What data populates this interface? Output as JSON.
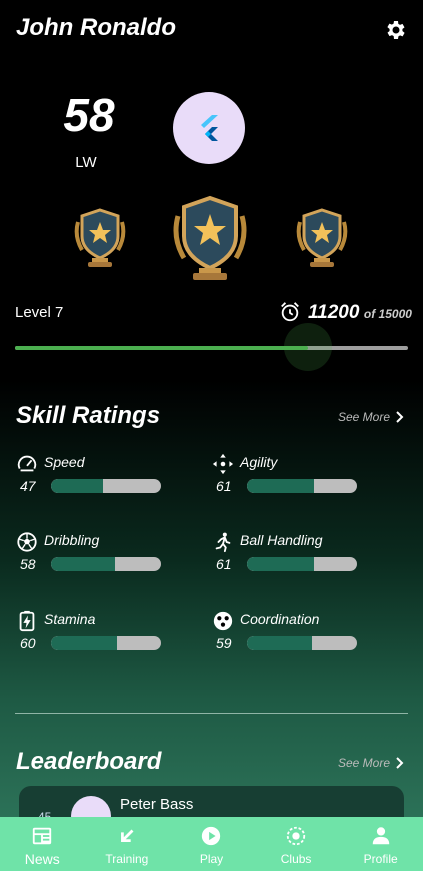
{
  "header": {
    "player_name": "John Ronaldo"
  },
  "profile": {
    "rating": "58",
    "position": "LW"
  },
  "level": {
    "label": "Level 7",
    "xp_current": "11200",
    "xp_of": "of 15000",
    "progress": 0.7467
  },
  "skills": {
    "title": "Skill Ratings",
    "see_more": "See More",
    "items": [
      {
        "name": "Speed",
        "value": "47",
        "icon": "speedometer-icon"
      },
      {
        "name": "Agility",
        "value": "61",
        "icon": "move-arrows-icon"
      },
      {
        "name": "Dribbling",
        "value": "58",
        "icon": "soccer-ball-icon"
      },
      {
        "name": "Ball Handling",
        "value": "61",
        "icon": "runner-icon"
      },
      {
        "name": "Stamina",
        "value": "60",
        "icon": "battery-bolt-icon"
      },
      {
        "name": "Coordination",
        "value": "59",
        "icon": "dots-circle-icon"
      }
    ]
  },
  "leaderboard": {
    "title": "Leaderboard",
    "see_more": "See More",
    "entries": [
      {
        "rank": "45",
        "name": "Peter Bass"
      }
    ]
  },
  "nav": {
    "items": [
      {
        "label": "News",
        "icon": "news-icon"
      },
      {
        "label": "Training",
        "icon": "arrow-icon"
      },
      {
        "label": "Play",
        "icon": "play-icon"
      },
      {
        "label": "Clubs",
        "icon": "clubs-icon"
      },
      {
        "label": "Profile",
        "icon": "profile-icon"
      }
    ]
  },
  "colors": {
    "accent_green": "#4caf50",
    "nav_bg": "#6fe3a8",
    "skill_fill": "#1e6b55",
    "avatar_bg": "#e9dcf9"
  }
}
